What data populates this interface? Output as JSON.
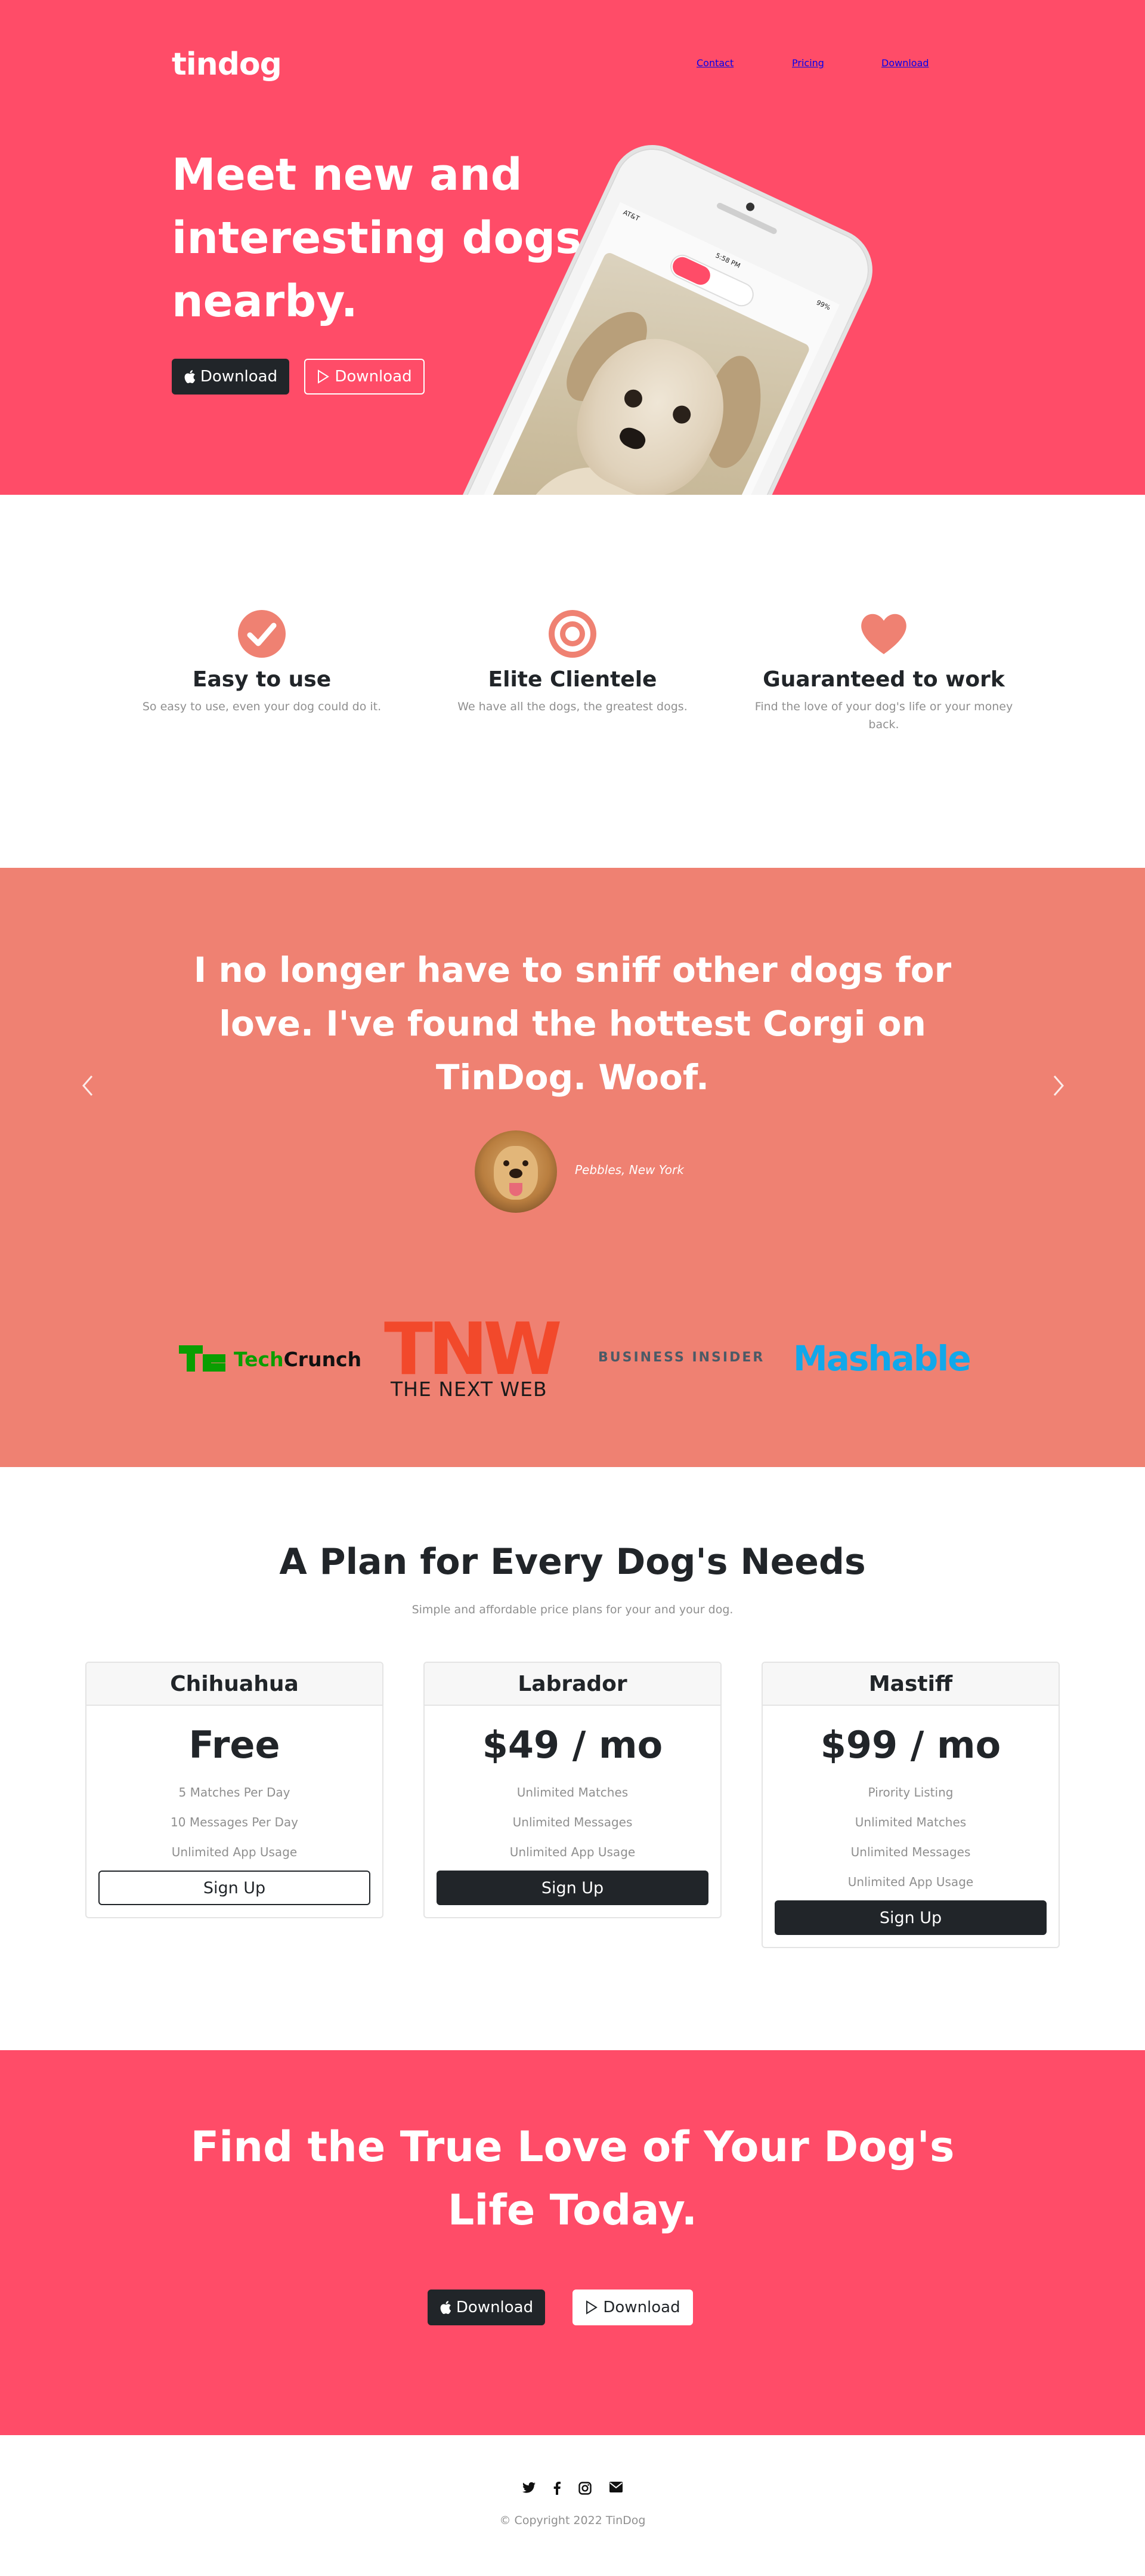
{
  "colors": {
    "hero": "#ff4c68",
    "testimonials": "#ef8172",
    "dark": "#212529",
    "muted": "#8f8f8f",
    "feature_icon": "#ef8172"
  },
  "nav": {
    "brand": "tindog",
    "links": [
      "Contact",
      "Pricing",
      "Download"
    ]
  },
  "hero": {
    "title": "Meet new and interesting dogs nearby.",
    "buttons": [
      {
        "icon": "apple-icon",
        "label": "Download"
      },
      {
        "icon": "google-play-icon",
        "label": "Download"
      }
    ],
    "phone": {
      "carrier": "AT&T",
      "time": "5:58 PM",
      "battery": "99%"
    }
  },
  "features": [
    {
      "icon": "check-circle-icon",
      "title": "Easy to use",
      "text": "So easy to use, even your dog could do it."
    },
    {
      "icon": "bullseye-icon",
      "title": "Elite Clientele",
      "text": "We have all the dogs, the greatest dogs."
    },
    {
      "icon": "heart-icon",
      "title": "Guaranteed to work",
      "text": "Find the love of your dog's life or your money back."
    }
  ],
  "testimonial": {
    "quote": "I no longer have to sniff other dogs for love. I've found the hottest Corgi on TinDog. Woof.",
    "author": "Pebbles, New York"
  },
  "press": {
    "techcrunch": {
      "mark": "TC",
      "tech": "Tech",
      "crunch": "Crunch"
    },
    "tnw": {
      "logo": "TNW",
      "sub": "THE NEXT WEB"
    },
    "business_insider": "BUSINESS INSIDER",
    "mashable": "Mashable"
  },
  "pricing": {
    "title": "A Plan for Every Dog's Needs",
    "subtitle": "Simple and affordable price plans for your and your dog.",
    "plans": [
      {
        "name": "Chihuahua",
        "price": "Free",
        "features": [
          "5 Matches Per Day",
          "10 Messages Per Day",
          "Unlimited App Usage"
        ],
        "button": "Sign Up"
      },
      {
        "name": "Labrador",
        "price": "$49 / mo",
        "features": [
          "Unlimited Matches",
          "Unlimited Messages",
          "Unlimited App Usage"
        ],
        "button": "Sign Up"
      },
      {
        "name": "Mastiff",
        "price": "$99 / mo",
        "features": [
          "Pirority Listing",
          "Unlimited Matches",
          "Unlimited Messages",
          "Unlimited App Usage"
        ],
        "button": "Sign Up"
      }
    ]
  },
  "cta": {
    "title": "Find the True Love of Your Dog's Life Today.",
    "buttons": [
      {
        "icon": "apple-icon",
        "label": "Download"
      },
      {
        "icon": "google-play-icon",
        "label": "Download"
      }
    ]
  },
  "footer": {
    "social": [
      "twitter-icon",
      "facebook-icon",
      "instagram-icon",
      "envelope-icon"
    ],
    "copyright": "© Copyright 2022 TinDog"
  }
}
